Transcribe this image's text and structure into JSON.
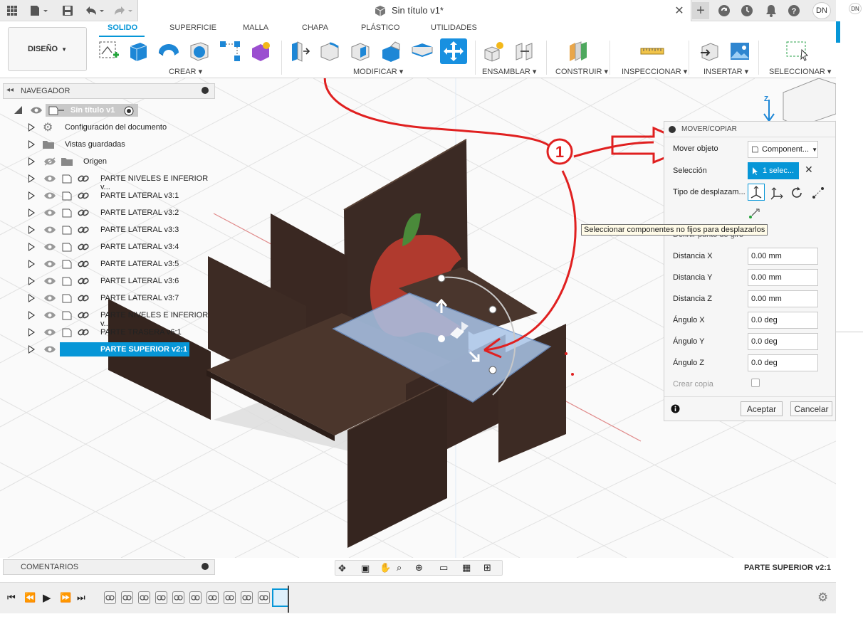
{
  "titlebar": {
    "doc_title": "Sin título v1*",
    "user_initials": "DN",
    "right_initials": "DN"
  },
  "toolbar": {
    "workspace_button": "DISEÑO",
    "tabs": [
      {
        "label": "SOLIDO",
        "active": true
      },
      {
        "label": "SUPERFICIE",
        "active": false
      },
      {
        "label": "MALLA",
        "active": false
      },
      {
        "label": "CHAPA",
        "active": false
      },
      {
        "label": "PLÁSTICO",
        "active": false
      },
      {
        "label": "UTILIDADES",
        "active": false
      }
    ],
    "groups": {
      "crear": "CREAR",
      "modificar": "MODIFICAR",
      "ensamblar": "ENSAMBLAR",
      "construir": "CONSTRUIR",
      "inspeccionar": "INSPECCIONAR",
      "insertar": "INSERTAR",
      "seleccionar": "SELECCIONAR"
    }
  },
  "navigator": {
    "title": "NAVEGADOR",
    "root": "Sin título v1",
    "items": [
      {
        "label": "Configuración del documento",
        "icon": "gear-icon"
      },
      {
        "label": "Vistas guardadas",
        "icon": "folder-icon"
      },
      {
        "label": "Origen",
        "icon": "folder-icon"
      },
      {
        "label": "PARTE NIVELES E INFERIOR v...",
        "icon": "component-icon"
      },
      {
        "label": "PARTE LATERAL v3:1",
        "icon": "component-icon"
      },
      {
        "label": "PARTE LATERAL v3:2",
        "icon": "component-icon"
      },
      {
        "label": "PARTE LATERAL v3:3",
        "icon": "component-icon"
      },
      {
        "label": "PARTE LATERAL v3:4",
        "icon": "component-icon"
      },
      {
        "label": "PARTE LATERAL v3:5",
        "icon": "component-icon"
      },
      {
        "label": "PARTE LATERAL v3:6",
        "icon": "component-icon"
      },
      {
        "label": "PARTE LATERAL v3:7",
        "icon": "component-icon"
      },
      {
        "label": "PARTE NIVELES E INFERIOR v...",
        "icon": "component-icon"
      },
      {
        "label": "PARTE TRASERA v6:1",
        "icon": "component-icon"
      },
      {
        "label": "PARTE SUPERIOR v2:1",
        "icon": "component-icon",
        "selected": true
      }
    ]
  },
  "dialog": {
    "title": "MOVER/COPIAR",
    "mover_objeto_label": "Mover objeto",
    "mover_objeto_value": "Component...",
    "seleccion_label": "Selección",
    "seleccion_value": "1 selec...",
    "tipo_label": "Tipo de desplazam...",
    "pivot_label": "Definir punto de giro",
    "fields": [
      {
        "label": "Distancia X",
        "value": "0.00 mm"
      },
      {
        "label": "Distancia Y",
        "value": "0.00 mm"
      },
      {
        "label": "Distancia Z",
        "value": "0.00 mm"
      },
      {
        "label": "Ángulo X",
        "value": "0.0 deg"
      },
      {
        "label": "Ángulo Y",
        "value": "0.0 deg"
      },
      {
        "label": "Ángulo Z",
        "value": "0.0 deg"
      }
    ],
    "crear_copia_label": "Crear copia",
    "accept": "Aceptar",
    "cancel": "Cancelar"
  },
  "tooltip": "Seleccionar componentes no fijos para desplazarlos",
  "annotation_number": "1",
  "comments": "COMENTARIOS",
  "status_selection": "PARTE SUPERIOR v2:1",
  "viewcube": {
    "axis_z": "Z"
  },
  "colors": {
    "accent": "#0696d7",
    "annotation": "#e02020",
    "wood": "#3b2a24",
    "apple_red": "#b03a2e",
    "apple_leaf": "#4a8a3a",
    "selected_plate": "#a9c4e8"
  }
}
